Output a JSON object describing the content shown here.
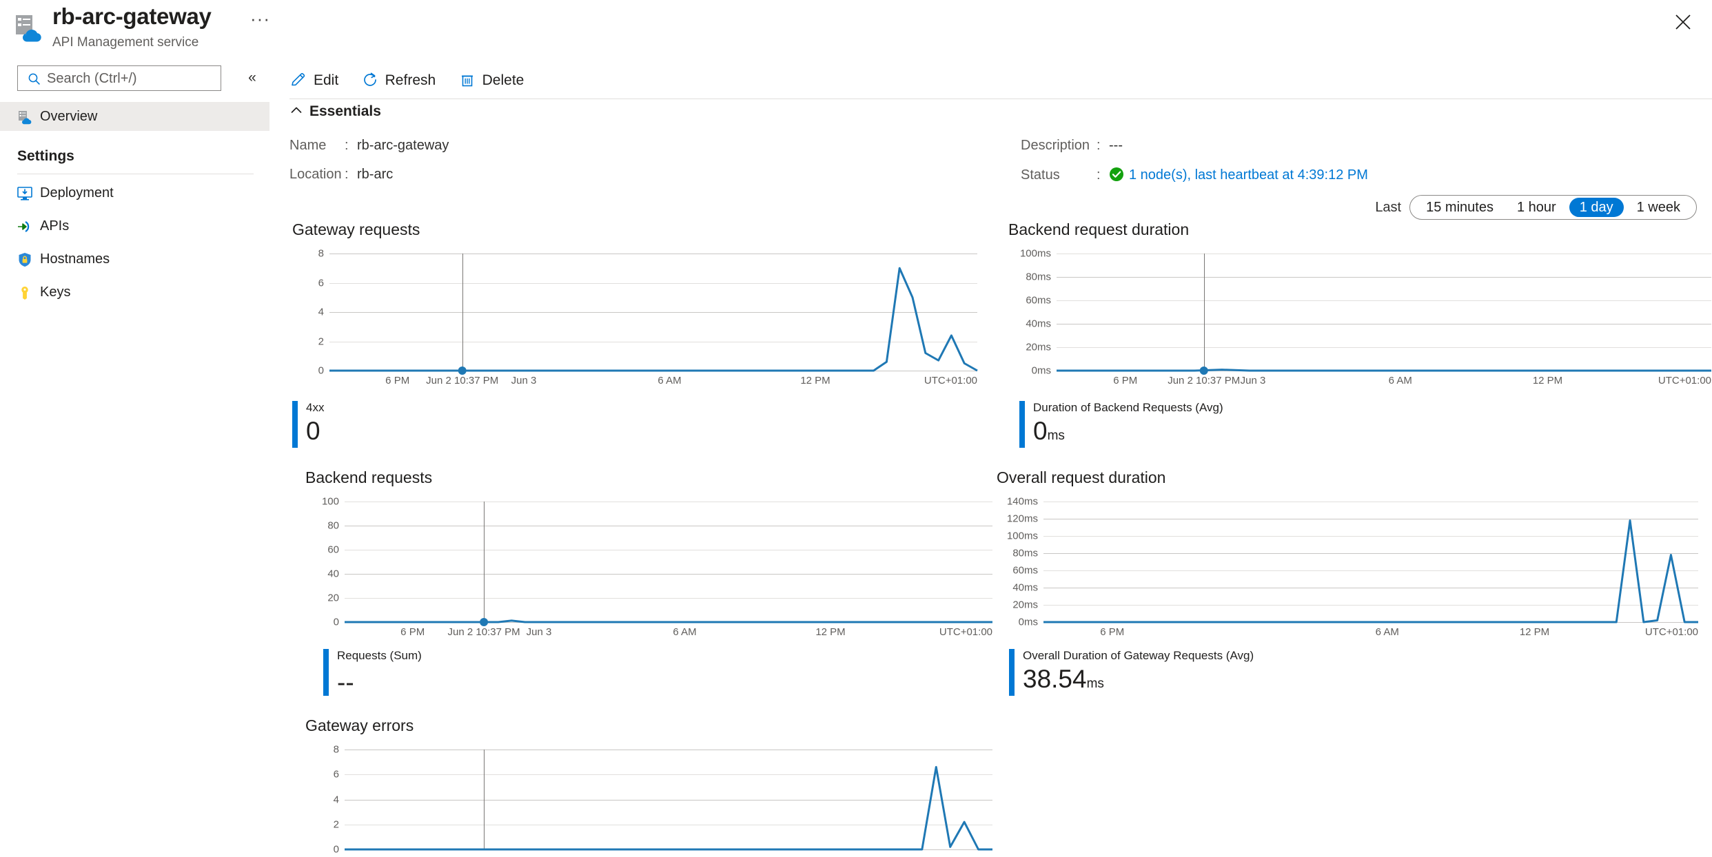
{
  "resource": {
    "title": "rb-arc-gateway",
    "subtitle": "API Management service",
    "more_label": "···",
    "icon": "api-management-icon"
  },
  "search": {
    "placeholder": "Search (Ctrl+/)",
    "value": "",
    "icon": "search-icon"
  },
  "collapse": {
    "glyph": "«"
  },
  "close": {
    "glyph": "close-icon"
  },
  "sidebar": {
    "overview": {
      "label": "Overview",
      "icon": "api-management-icon",
      "selected": true
    },
    "settings_header": "Settings",
    "items": [
      {
        "label": "Deployment",
        "icon": "deployment-icon"
      },
      {
        "label": "APIs",
        "icon": "apis-arrow-icon"
      },
      {
        "label": "Hostnames",
        "icon": "shield-lock-icon"
      },
      {
        "label": "Keys",
        "icon": "key-icon"
      }
    ]
  },
  "toolbar": [
    {
      "label": "Edit",
      "icon": "pencil-icon"
    },
    {
      "label": "Refresh",
      "icon": "refresh-icon"
    },
    {
      "label": "Delete",
      "icon": "trash-icon"
    }
  ],
  "essentials": {
    "label": "Essentials",
    "chevron": "chevron-up-icon",
    "left": [
      {
        "key": "Name",
        "sep": ":",
        "value": "rb-arc-gateway"
      },
      {
        "key": "Location",
        "sep": ":",
        "value": "rb-arc"
      }
    ],
    "right": [
      {
        "key": "Description",
        "sep": ":",
        "value": "---"
      },
      {
        "key": "Status",
        "sep": ":",
        "value": "1 node(s), last heartbeat at 4:39:12 PM",
        "icon": "success-check-icon",
        "link": true
      }
    ]
  },
  "time_range": {
    "label": "Last",
    "options": [
      {
        "label": "15 minutes",
        "selected": false
      },
      {
        "label": "1 hour",
        "selected": false
      },
      {
        "label": "1 day",
        "selected": true
      },
      {
        "label": "1 week",
        "selected": false
      }
    ]
  },
  "colors": {
    "accent": "#0078d4",
    "series": "#1f78b4",
    "success": "#107c10",
    "grid": "#c8c6c4",
    "selected_nav_bg": "#edebe9"
  },
  "chart_data": [
    {
      "id": "gateway-requests",
      "type": "line",
      "title": "Gateway requests",
      "xlabel": "",
      "ylabel": "",
      "ylim": [
        0,
        8
      ],
      "yticks": [
        0,
        2,
        4,
        6,
        8
      ],
      "ytick_labels": [
        "0",
        "2",
        "4",
        "6",
        "8"
      ],
      "xtick_labels": [
        "6 PM",
        "Jun 3",
        "6 AM",
        "12 PM",
        "UTC+01:00"
      ],
      "cursor_label": "Jun 2 10:37 PM",
      "grid": true,
      "legend": {
        "name": "4xx",
        "value": "0",
        "unit": ""
      },
      "series": [
        {
          "name": "4xx",
          "x": [
            0,
            4,
            8,
            12,
            16,
            20,
            24,
            28,
            32,
            36,
            40,
            44,
            48,
            52,
            56,
            60,
            64,
            68,
            72,
            76,
            80,
            82,
            84,
            86,
            88,
            90,
            92,
            94,
            96,
            98,
            100
          ],
          "values": [
            0,
            0,
            0,
            0,
            0,
            0,
            0,
            0,
            0,
            0,
            0,
            0,
            0,
            0,
            0,
            0,
            0,
            0,
            0,
            0,
            0,
            0,
            0,
            0.6,
            7,
            5,
            1.2,
            0.7,
            2.4,
            0.5,
            0
          ]
        }
      ],
      "marker": {
        "x": 20,
        "y": 0
      }
    },
    {
      "id": "backend-request-duration",
      "type": "line",
      "title": "Backend request duration",
      "xlabel": "",
      "ylabel": "",
      "ylim": [
        0,
        100
      ],
      "yticks": [
        0,
        20,
        40,
        60,
        80,
        100
      ],
      "ytick_labels": [
        "0ms",
        "20ms",
        "40ms",
        "60ms",
        "80ms",
        "100ms"
      ],
      "xtick_labels": [
        "6 PM",
        "Jun 3",
        "6 AM",
        "12 PM",
        "UTC+01:00"
      ],
      "cursor_label": "Jun 2 10:37 PM",
      "grid": true,
      "legend": {
        "name": "Duration of Backend Requests (Avg)",
        "value": "0",
        "unit": "ms"
      },
      "series": [
        {
          "name": "Duration of Backend Requests (Avg)",
          "x": [
            0,
            10,
            20,
            24,
            28,
            30,
            40,
            50,
            60,
            70,
            80,
            90,
            95
          ],
          "values": [
            0,
            0,
            0,
            0.8,
            0,
            0,
            0,
            0,
            0,
            0,
            0,
            0,
            0
          ]
        }
      ],
      "marker": {
        "x": 25,
        "y": 0
      }
    },
    {
      "id": "backend-requests",
      "type": "line",
      "title": "Backend requests",
      "xlabel": "",
      "ylabel": "",
      "ylim": [
        0,
        100
      ],
      "yticks": [
        0,
        20,
        40,
        60,
        80,
        100
      ],
      "ytick_labels": [
        "0",
        "20",
        "40",
        "60",
        "80",
        "100"
      ],
      "xtick_labels": [
        "6 PM",
        "Jun 3",
        "6 AM",
        "12 PM",
        "UTC+01:00"
      ],
      "cursor_label": "Jun 2 10:37 PM",
      "grid": true,
      "legend": {
        "name": "Requests (Sum)",
        "value": "--",
        "unit": ""
      },
      "series": [
        {
          "name": "Requests (Sum)",
          "x": [
            0,
            10,
            20,
            23,
            25,
            27,
            30,
            40,
            50,
            60,
            70,
            80,
            90,
            97
          ],
          "values": [
            0,
            0,
            0,
            0,
            1.2,
            0,
            0,
            0,
            0,
            0,
            0,
            0,
            0,
            0
          ]
        }
      ],
      "marker": {
        "x": 25,
        "y": 0
      }
    },
    {
      "id": "overall-request-duration",
      "type": "line",
      "title": "Overall request duration",
      "xlabel": "",
      "ylabel": "",
      "ylim": [
        0,
        140
      ],
      "yticks": [
        0,
        20,
        40,
        60,
        80,
        100,
        120,
        140
      ],
      "ytick_labels": [
        "0ms",
        "20ms",
        "40ms",
        "60ms",
        "80ms",
        "100ms",
        "120ms",
        "140ms"
      ],
      "xtick_labels": [
        "6 PM",
        "6 AM",
        "12 PM",
        "UTC+01:00"
      ],
      "cursor_label": "",
      "grid": true,
      "legend": {
        "name": "Overall Duration of Gateway Requests (Avg)",
        "value": "38.54",
        "unit": "ms"
      },
      "series": [
        {
          "name": "Overall Duration of Gateway Requests (Avg)",
          "x": [
            0,
            10,
            20,
            30,
            40,
            50,
            60,
            70,
            80,
            84,
            86,
            88,
            90,
            92,
            94,
            96
          ],
          "values": [
            0,
            0,
            0,
            0,
            0,
            0,
            0,
            0,
            0,
            0,
            118,
            0,
            2,
            78,
            0,
            0
          ]
        }
      ],
      "marker": null
    },
    {
      "id": "gateway-errors",
      "type": "line",
      "title": "Gateway errors",
      "xlabel": "",
      "ylabel": "",
      "ylim": [
        0,
        8
      ],
      "yticks": [
        0,
        2,
        4,
        6,
        8
      ],
      "ytick_labels": [
        "0",
        "2",
        "4",
        "6",
        "8"
      ],
      "xtick_labels": [],
      "cursor_label": "",
      "grid": true,
      "legend": null,
      "series": [
        {
          "name": "errors",
          "x": [
            0,
            20,
            40,
            60,
            75,
            82,
            84,
            86,
            88,
            90,
            92
          ],
          "values": [
            0,
            0,
            0,
            0,
            0,
            0,
            6.6,
            0.2,
            2.2,
            0,
            0
          ]
        }
      ],
      "marker": null
    }
  ]
}
